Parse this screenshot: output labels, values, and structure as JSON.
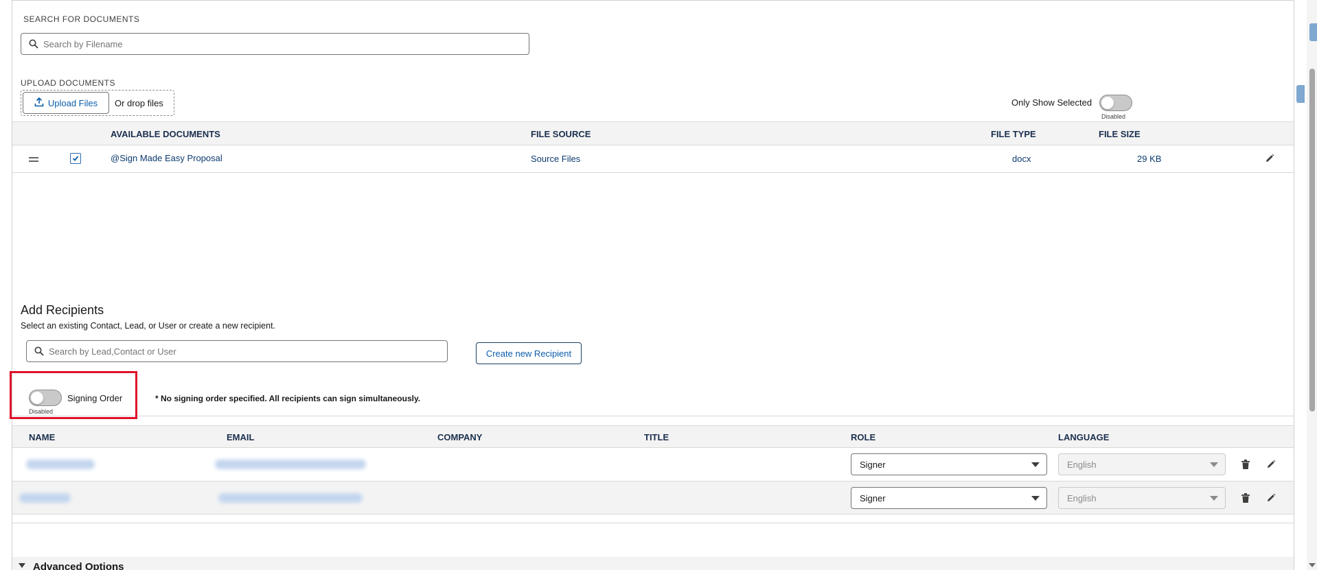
{
  "search_docs": {
    "label": "SEARCH FOR DOCUMENTS",
    "placeholder": "Search by Filename"
  },
  "upload": {
    "label": "UPLOAD DOCUMENTS",
    "button_label": "Upload Files",
    "drop_text": "Or drop files"
  },
  "only_show_selected": {
    "label": "Only Show Selected",
    "state": "Disabled"
  },
  "documents_table": {
    "headers": [
      "AVAILABLE DOCUMENTS",
      "FILE SOURCE",
      "FILE TYPE",
      "FILE SIZE"
    ],
    "rows": [
      {
        "checked": true,
        "name": "@Sign Made Easy Proposal",
        "source": "Source Files",
        "type": "docx",
        "size": "29 KB"
      }
    ]
  },
  "recipients": {
    "title": "Add Recipients",
    "subtitle": "Select an existing Contact, Lead, or User or create a new recipient.",
    "search_placeholder": "Search by Lead,Contact or User",
    "create_button": "Create new Recipient",
    "signing_order_label": "Signing Order",
    "signing_order_state": "Disabled",
    "signing_note": "* No signing order specified. All recipients can sign simultaneously.",
    "headers": [
      "NAME",
      "EMAIL",
      "COMPANY",
      "TITLE",
      "ROLE",
      "LANGUAGE"
    ],
    "rows": [
      {
        "role": "Signer",
        "language": "English"
      },
      {
        "role": "Signer",
        "language": "English"
      }
    ]
  },
  "advanced": {
    "label": "Advanced Options"
  },
  "colors": {
    "link": "#0b5cab",
    "header_text": "#1b2f4e",
    "highlight": "#e0102a",
    "toggle_off": "#c9c9c9"
  }
}
